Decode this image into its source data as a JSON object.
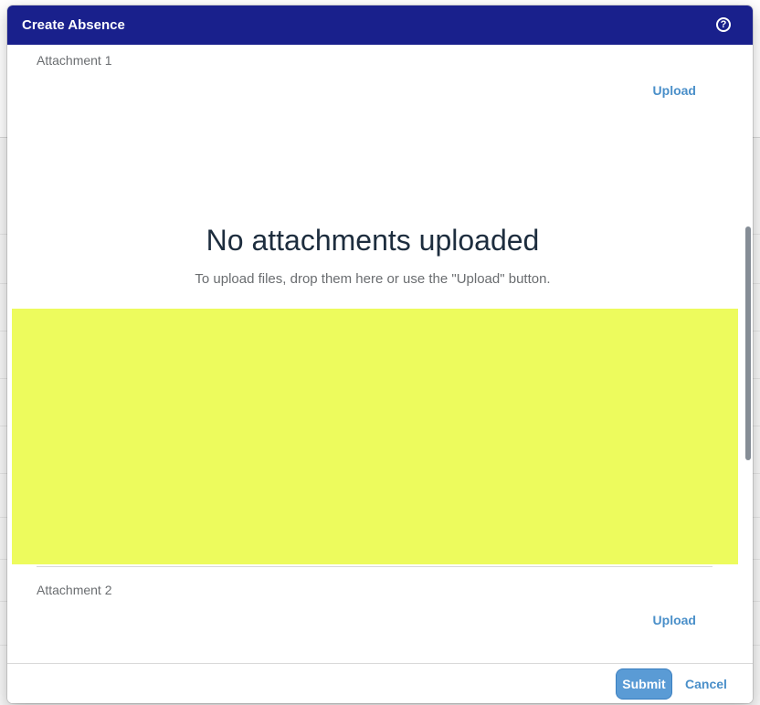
{
  "dialog": {
    "title": "Create Absence",
    "help_icon": "help-circle-icon",
    "header_color": "#19208c"
  },
  "attachments": [
    {
      "label": "Attachment 1",
      "upload_label": "Upload"
    },
    {
      "label": "Attachment 2",
      "upload_label": "Upload"
    }
  ],
  "empty_state": {
    "title": "No attachments uploaded",
    "subtitle": "To upload files, drop them here or use the \"Upload\" button."
  },
  "drop_zone_color": "#edfb5d",
  "footer": {
    "submit_label": "Submit",
    "cancel_label": "Cancel"
  },
  "accent_color": "#4a8fc9"
}
